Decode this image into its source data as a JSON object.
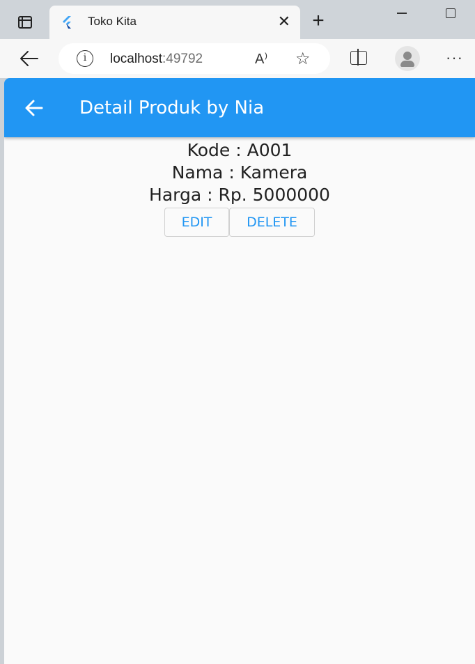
{
  "browser": {
    "tab": {
      "title": "Toko Kita"
    },
    "address": {
      "host": "localhost",
      "port": ":49792"
    }
  },
  "app": {
    "appbar": {
      "title": "Detail Produk by Nia"
    },
    "product": {
      "kode": "Kode : A001",
      "nama": "Nama : Kamera",
      "harga": "Harga : Rp. 5000000"
    },
    "buttons": {
      "edit": "EDIT",
      "delete": "DELETE"
    }
  },
  "colors": {
    "primary": "#2196f3",
    "background": "#fafafa"
  }
}
